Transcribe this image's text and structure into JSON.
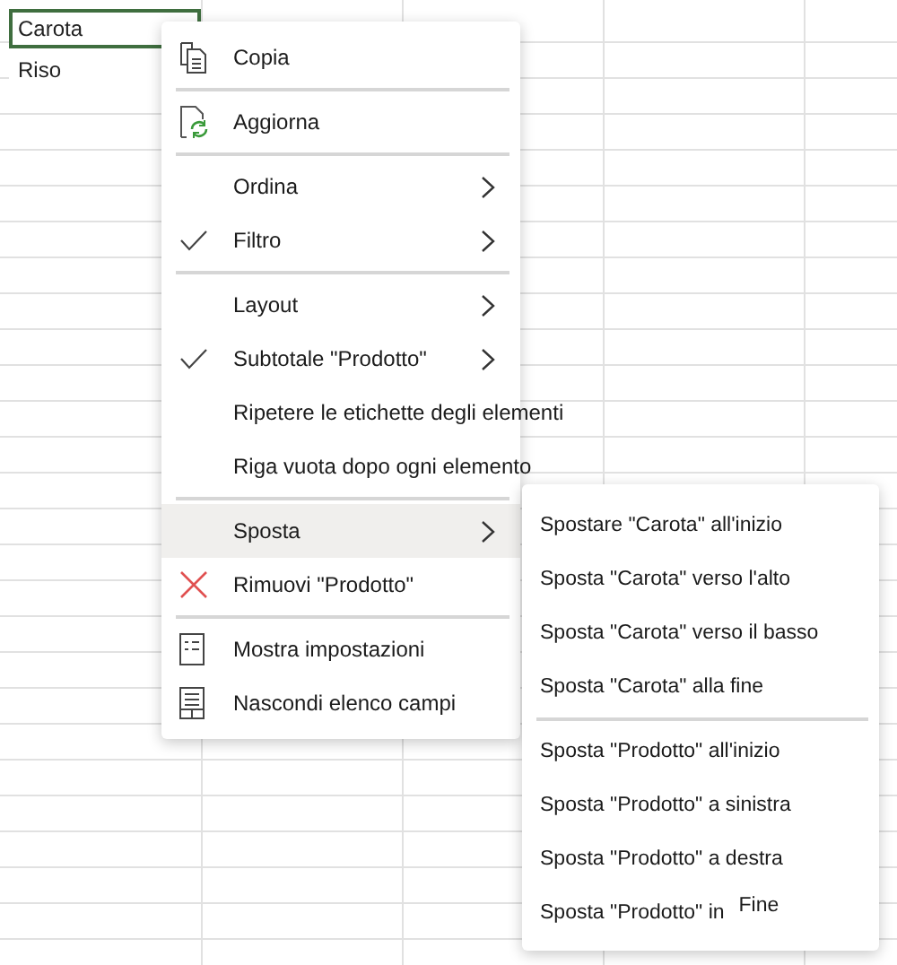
{
  "sheet": {
    "cells": [
      {
        "text": "Carota",
        "selected": true
      },
      {
        "text": "Riso",
        "selected": false
      }
    ]
  },
  "menu": {
    "sections": [
      [
        {
          "label": "Copia",
          "kind": "copy",
          "has_submenu": false,
          "selected": false
        }
      ],
      [
        {
          "label": "Aggiorna",
          "kind": "refresh",
          "has_submenu": false,
          "selected": false
        }
      ],
      [
        {
          "label": "Ordina",
          "kind": "toggle",
          "checked": false,
          "has_submenu": true,
          "selected": false
        },
        {
          "label": "Filtro",
          "kind": "toggle",
          "checked": true,
          "has_submenu": true,
          "selected": false
        }
      ],
      [
        {
          "label": "Layout",
          "kind": "toggle",
          "checked": false,
          "has_submenu": true,
          "selected": false
        },
        {
          "label": "Subtotale \"Prodotto\"",
          "kind": "toggle",
          "checked": true,
          "has_submenu": true,
          "selected": false
        },
        {
          "label": "Ripetere le etichette degli elementi",
          "kind": "toggle",
          "checked": false,
          "has_submenu": false,
          "selected": false
        },
        {
          "label": "Riga vuota dopo ogni elemento",
          "kind": "toggle",
          "checked": false,
          "has_submenu": false,
          "selected": false
        }
      ],
      [
        {
          "label": "Sposta",
          "kind": "toggle",
          "checked": false,
          "has_submenu": true,
          "selected": true
        },
        {
          "label": "Rimuovi \"Prodotto\"",
          "kind": "remove",
          "has_submenu": false,
          "selected": false
        }
      ],
      [
        {
          "label": "Mostra impostazioni",
          "kind": "settings",
          "has_submenu": false,
          "selected": false
        },
        {
          "label": "Nascondi elenco campi",
          "kind": "fields",
          "has_submenu": false,
          "selected": false
        }
      ]
    ]
  },
  "submenu": {
    "sections": [
      [
        {
          "label": "Spostare \"Carota\" all'inizio"
        },
        {
          "label": "Sposta \"Carota\" verso l'alto"
        },
        {
          "label": "Sposta \"Carota\" verso il basso"
        },
        {
          "label": "Sposta \"Carota\" alla fine"
        }
      ],
      [
        {
          "label": "Sposta \"Prodotto\" all'inizio"
        },
        {
          "label": "Sposta \"Prodotto\" a sinistra"
        },
        {
          "label": "Sposta \"Prodotto\" a destra"
        },
        {
          "label": "Sposta \"Prodotto\" in",
          "suffix": "Fine"
        }
      ]
    ]
  }
}
